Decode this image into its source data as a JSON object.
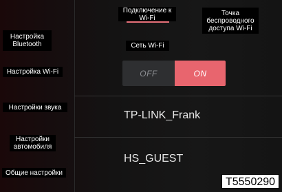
{
  "sidebar": {
    "items": [
      {
        "label": "Настройка Bluetooth"
      },
      {
        "label": "Настройка Wi-Fi"
      },
      {
        "label": "Настройки звука"
      },
      {
        "label": "Настройки автомобиля"
      },
      {
        "label": "Общие настройки"
      }
    ]
  },
  "tabs": [
    {
      "label": "Подключение к Wi-Fi",
      "active": true
    },
    {
      "label": "Точка беспроводного доступа Wi-Fi",
      "active": false
    }
  ],
  "wifi_label": "Сеть Wi-Fi",
  "toggle": {
    "off_label": "OFF",
    "on_label": "ON",
    "state": "on"
  },
  "networks": [
    {
      "ssid": "TP-LINK_Frank"
    },
    {
      "ssid": "HS_GUEST"
    }
  ],
  "image_code": "T5550290",
  "colors": {
    "accent": "#e8656e",
    "off_bg": "#2e2f31"
  }
}
